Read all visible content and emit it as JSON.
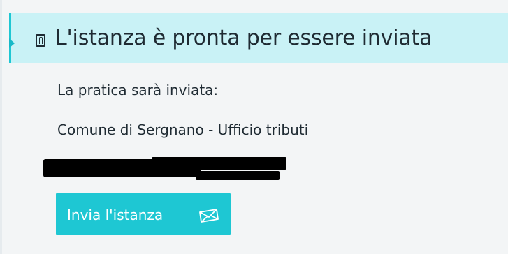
{
  "panel": {
    "title": "L'istanza è pronta per essere inviata",
    "header_icon": "document-lock-icon"
  },
  "body": {
    "line1": "La pratica sarà inviata:",
    "line2": "Comune di Sergnano - Ufficio tributi"
  },
  "actions": {
    "submit_label": "Invia l'istanza",
    "submit_icon": "envelope-icon"
  },
  "colors": {
    "accent": "#1ec7d3",
    "header_bg": "#c9f2f6",
    "text": "#1f2b33"
  }
}
